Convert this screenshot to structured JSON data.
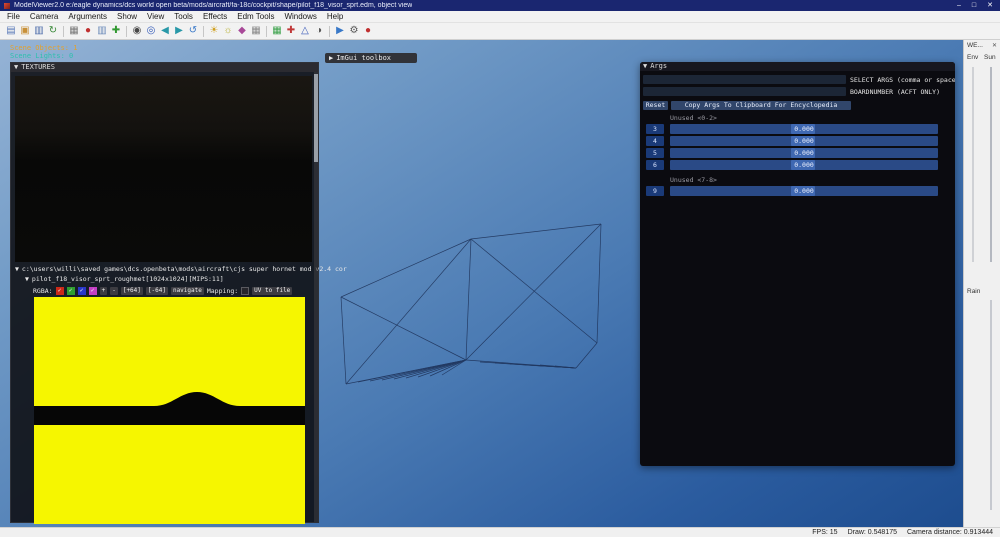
{
  "icons": {
    "collapse_down": "▼",
    "collapse_right": "▶",
    "close": "✕",
    "minimize": "–",
    "maximize": "□",
    "check": "✓"
  },
  "title_bar": {
    "title": "ModelViewer2.0 e:/eagle dynamics/dcs world open beta/mods/aircraft/fa-18c/cockpit/shape/pilot_f18_visor_sprt.edm, object view"
  },
  "menu_bar": {
    "items": [
      "File",
      "Camera",
      "Arguments",
      "Show",
      "View",
      "Tools",
      "Effects",
      "Edm Tools",
      "Windows",
      "Help"
    ]
  },
  "toolbar": {
    "icons": [
      {
        "name": "open-model-icon",
        "glyph": "▤",
        "color": "#5878b8"
      },
      {
        "name": "open-folder-icon",
        "glyph": "▣",
        "color": "#c89038"
      },
      {
        "name": "save-model-icon",
        "glyph": "▥",
        "color": "#4868a8"
      },
      {
        "name": "reload-model-icon",
        "glyph": "↻",
        "color": "#388838"
      },
      {
        "name": "screenshot-icon",
        "glyph": "▦",
        "color": "#787878"
      },
      {
        "name": "record-icon",
        "glyph": "●",
        "color": "#c03030"
      },
      {
        "name": "copy-icon",
        "glyph": "▥",
        "color": "#6888b8"
      },
      {
        "name": "add-object-icon",
        "glyph": "✚",
        "color": "#309830"
      },
      {
        "name": "camera-icon",
        "glyph": "◉",
        "color": "#484848"
      },
      {
        "name": "focus-icon",
        "glyph": "◎",
        "color": "#3058b8"
      },
      {
        "name": "prev-view-icon",
        "glyph": "◀",
        "color": "#2898a8"
      },
      {
        "name": "next-view-icon",
        "glyph": "▶",
        "color": "#2898a8"
      },
      {
        "name": "rotate-icon",
        "glyph": "↺",
        "color": "#3878c8"
      },
      {
        "name": "sun-icon",
        "glyph": "☀",
        "color": "#d0a020"
      },
      {
        "name": "bulb-icon",
        "glyph": "☼",
        "color": "#b8b030"
      },
      {
        "name": "material-icon",
        "glyph": "◆",
        "color": "#a84898"
      },
      {
        "name": "texture-icon",
        "glyph": "▦",
        "color": "#888888"
      },
      {
        "name": "grid-icon",
        "glyph": "▦",
        "color": "#38a048"
      },
      {
        "name": "axes-icon",
        "glyph": "✚",
        "color": "#c03838"
      },
      {
        "name": "wireframe-icon",
        "glyph": "△",
        "color": "#3858b8"
      },
      {
        "name": "shading-icon",
        "glyph": "◑",
        "color": "#585858"
      },
      {
        "name": "play-anim-icon",
        "glyph": "▶",
        "color": "#3878c8"
      },
      {
        "name": "settings-icon",
        "glyph": "⚙",
        "color": "#585858"
      },
      {
        "name": "stop-icon",
        "glyph": "●",
        "color": "#c03030"
      }
    ]
  },
  "viewport": {
    "scene_objects": "Scene Objects: 1",
    "scene_lights": "Scene Lights: 0",
    "imgui_toolbox_label": "ImGui toolbox"
  },
  "textures_panel": {
    "header": "TEXTURES",
    "path_line": "c:\\users\\willi\\saved games\\dcs.openbeta\\mods\\aircraft\\cjs super hornet mod v2.4 cor",
    "texture_line": "pilot_f18_visor_sprt_roughmet[1024x1024][MIPS:11]",
    "rgba_label": "RGBA:",
    "plus_button": "+",
    "minus_button": "-",
    "plus64_button": "[+64]",
    "minus64_button": "[-64]",
    "navigate_button": "navigate",
    "mapping_label": "Mapping:",
    "uv_button": "UV to file"
  },
  "args_panel": {
    "header": "Args",
    "select_args_label": "SELECT ARGS (comma or space s",
    "boardnumber_label": "BOARDNUMBER (ACFT ONLY)",
    "reset_button": "Reset",
    "copy_button": "Copy Args To Clipboard For Encyclopedia",
    "group1_label": "Unused <0-2>",
    "group2_label": "Unused <7-8>",
    "rows": [
      {
        "id": "3",
        "value": "0.000"
      },
      {
        "id": "4",
        "value": "0.000"
      },
      {
        "id": "5",
        "value": "0.000"
      },
      {
        "id": "6",
        "value": "0.000"
      },
      {
        "id": "9",
        "value": "0.000"
      }
    ]
  },
  "weather_panel": {
    "title": "WE...",
    "env_label": "Env",
    "sun_label": "Sun",
    "rain_label": "Rain"
  },
  "status_bar": {
    "fps": "FPS: 15",
    "draw": "Draw: 0.548175",
    "camera": "Camera distance: 0.913444"
  }
}
